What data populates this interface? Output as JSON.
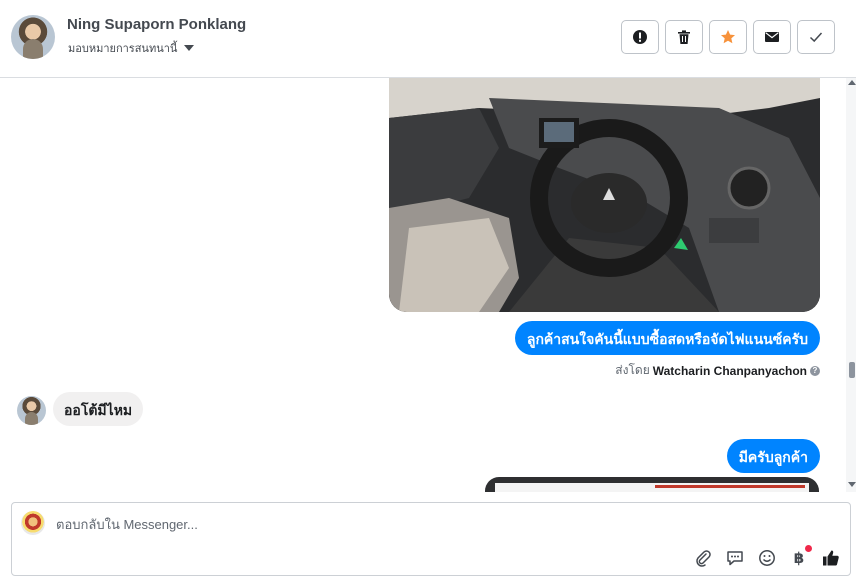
{
  "header": {
    "contact_name": "Ning Supaporn Ponklang",
    "assign_label": "มอบหมายการสนทนานี้",
    "actions": [
      {
        "name": "mark-spam",
        "icon": "exclamation-circle-icon"
      },
      {
        "name": "delete",
        "icon": "trash-icon"
      },
      {
        "name": "star",
        "icon": "star-icon",
        "color": "#f7923b"
      },
      {
        "name": "mark-unread",
        "icon": "envelope-icon"
      },
      {
        "name": "mark-done",
        "icon": "checkmark-icon"
      }
    ]
  },
  "thread": {
    "messages": [
      {
        "direction": "out",
        "type": "image",
        "description": "car-interior-photo"
      },
      {
        "direction": "out",
        "type": "text",
        "text": "ลูกค้าสนใจคันนี้แบบซื้อสดหรือจัดไฟแนนซ์ครับ"
      },
      {
        "direction": "in",
        "type": "text",
        "text": "ออโต้มีไหม"
      },
      {
        "direction": "out",
        "type": "text",
        "text": "มีครับลูกค้า"
      },
      {
        "direction": "out",
        "type": "image",
        "description": "partial-photo"
      }
    ],
    "sent_by_prefix": "ส่งโดย",
    "sent_by_name": "Watcharin Chanpanyachon"
  },
  "composer": {
    "placeholder": "ตอบกลับใน Messenger...",
    "tools": [
      "paperclip-icon",
      "speech-bubble-icon",
      "smiley-icon",
      "baht-icon",
      "thumbs-up-icon"
    ],
    "baht_symbol": "฿"
  },
  "colors": {
    "accent": "#0084ff",
    "incoming_bubble": "#f1f0f0",
    "star": "#f7923b",
    "notification_dot": "#f0284a"
  }
}
